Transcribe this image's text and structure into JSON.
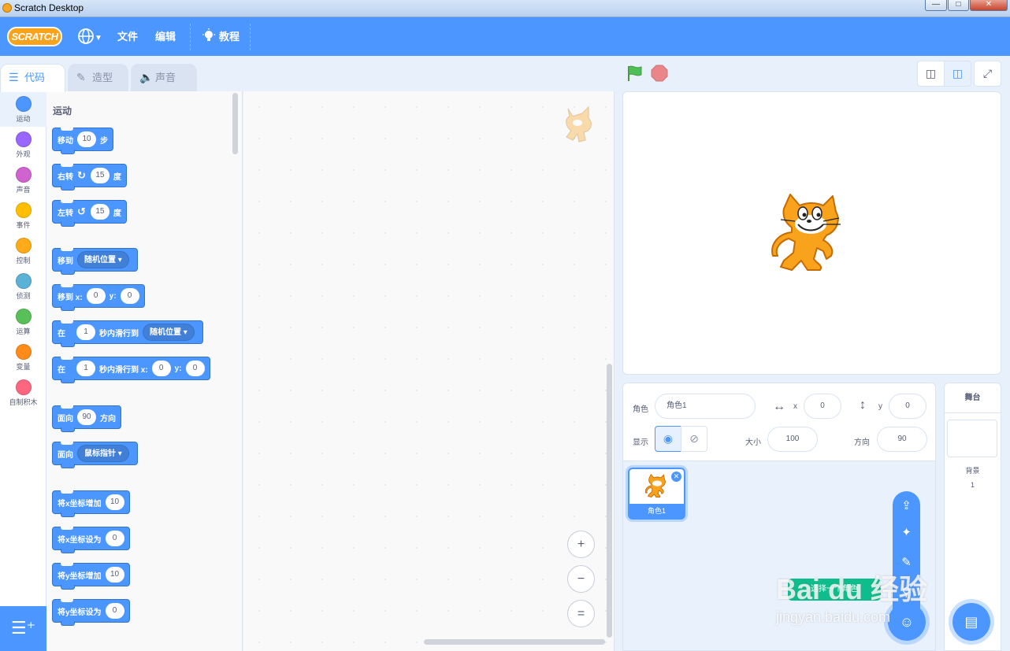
{
  "window": {
    "title": "Scratch Desktop",
    "min": "—",
    "max": "□",
    "close": "✕"
  },
  "menu": {
    "logo": "SCRATCH",
    "file": "文件",
    "edit": "编辑",
    "tutorials": "教程"
  },
  "tabs": [
    {
      "label": "代码",
      "icon": "code-icon"
    },
    {
      "label": "造型",
      "icon": "paintbrush-icon"
    },
    {
      "label": "声音",
      "icon": "speaker-icon"
    }
  ],
  "categories": [
    {
      "label": "运动",
      "color": "#4c97ff"
    },
    {
      "label": "外观",
      "color": "#9966ff"
    },
    {
      "label": "声音",
      "color": "#cf63cf"
    },
    {
      "label": "事件",
      "color": "#ffbf00"
    },
    {
      "label": "控制",
      "color": "#ffab19"
    },
    {
      "label": "侦测",
      "color": "#5cb1d6"
    },
    {
      "label": "运算",
      "color": "#59c059"
    },
    {
      "label": "变量",
      "color": "#ff8c1a"
    },
    {
      "label": "自制积木",
      "color": "#ff6680"
    }
  ],
  "palette": {
    "section_title": "运动",
    "move": {
      "a": "移动",
      "val": "10",
      "b": "步"
    },
    "turn_right": {
      "a": "右转",
      "val": "15",
      "b": "度"
    },
    "turn_left": {
      "a": "左转",
      "val": "15",
      "b": "度"
    },
    "goto": {
      "a": "移到",
      "drop": "随机位置"
    },
    "goto_xy": {
      "a": "移到 x:",
      "x": "0",
      "b": "y:",
      "y": "0"
    },
    "glide": {
      "a": "在",
      "val": "1",
      "b": "秒内滑行到",
      "drop": "随机位置"
    },
    "glide_xy": {
      "a": "在",
      "val": "1",
      "b": "秒内滑行到 x:",
      "x": "0",
      "c": "y:",
      "y": "0"
    },
    "point_dir": {
      "a": "面向",
      "val": "90",
      "b": "方向"
    },
    "point_towards": {
      "a": "面向",
      "drop": "鼠标指针"
    },
    "change_x": {
      "a": "将x坐标增加",
      "val": "10"
    },
    "set_x": {
      "a": "将x坐标设为",
      "val": "0"
    },
    "change_y": {
      "a": "将y坐标增加",
      "val": "10"
    },
    "set_y": {
      "a": "将y坐标设为",
      "val": "0"
    }
  },
  "zoom": {
    "in": "+",
    "out": "−",
    "reset": "="
  },
  "sprite_info": {
    "sprite_label": "角色",
    "sprite_name": "角色1",
    "x_label": "x",
    "x": "0",
    "y_label": "y",
    "y": "0",
    "show_label": "显示",
    "size_label": "大小",
    "size": "100",
    "direction_label": "方向",
    "direction": "90"
  },
  "sprite_tile": {
    "name": "角色1"
  },
  "stage_pane": {
    "title": "舞台",
    "backdrop_label": "背景",
    "backdrop_count": "1"
  },
  "tooltip": "选择一个角色",
  "watermark": {
    "brand": "Bai du 经验",
    "url": "jingyan.baidu.com"
  }
}
